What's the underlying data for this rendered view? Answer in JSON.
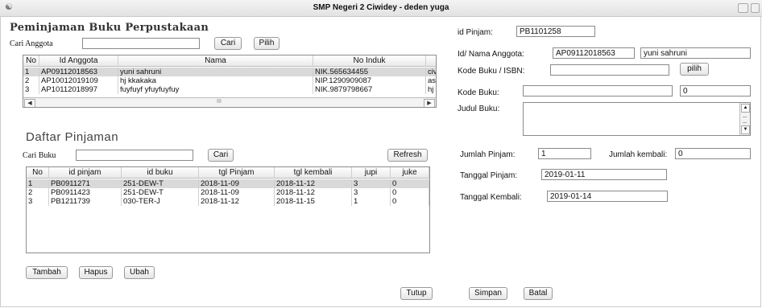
{
  "window": {
    "title": "SMP Negeri 2 Ciwidey - deden yuga"
  },
  "left": {
    "heading": "Peminjaman Buku Perpustakaan",
    "cari_anggota_label": "Cari Anggota",
    "cari_anggota_value": "",
    "cari_button": "Cari",
    "pilih_button": "Pilih",
    "anggota_table": {
      "columns": [
        "No",
        "Id Anggota",
        "Nama",
        "No Induk"
      ],
      "rows": [
        {
          "no": "1",
          "id": "AP09112018563",
          "nama": "yuni sahruni",
          "induk": "NIK.565634455",
          "extra": "civ"
        },
        {
          "no": "2",
          "id": "AP10012019109",
          "nama": "hj kkakaka",
          "induk": "NIP.1290909087",
          "extra": "as"
        },
        {
          "no": "3",
          "id": "AP10112018997",
          "nama": "fuyfuyf yfuyfuyfuy",
          "induk": "NIK.9879798667",
          "extra": "hj"
        }
      ],
      "scroll_thumb": "III"
    },
    "daftar_heading": "Daftar Pinjaman",
    "cari_buku_label": "Cari Buku",
    "cari_buku_value": "",
    "cari_buku_button": "Cari",
    "refresh_button": "Refresh",
    "pinjam_table": {
      "columns": [
        "No",
        "id pinjam",
        "id buku",
        "tgl Pinjam",
        "tgl kembali",
        "jupi",
        "juke"
      ],
      "rows": [
        {
          "no": "1",
          "id_pinjam": "PB0911271",
          "id_buku": "251-DEW-T",
          "tgl_pinjam": "2018-11-09",
          "tgl_kembali": "2018-11-12",
          "jupi": "3",
          "juke": "0"
        },
        {
          "no": "2",
          "id_pinjam": "PB0911423",
          "id_buku": "251-DEW-T",
          "tgl_pinjam": "2018-11-09",
          "tgl_kembali": "2018-11-12",
          "jupi": "3",
          "juke": "0"
        },
        {
          "no": "3",
          "id_pinjam": "PB1211739",
          "id_buku": "030-TER-J",
          "tgl_pinjam": "2018-11-12",
          "tgl_kembali": "2018-11-15",
          "jupi": "1",
          "juke": "0"
        }
      ]
    },
    "tambah_button": "Tambah",
    "hapus_button": "Hapus",
    "ubah_button": "Ubah",
    "tutup_button": "Tutup"
  },
  "right": {
    "id_pinjam_label": "id Pinjam:",
    "id_pinjam_value": "PB1101258",
    "anggota_label": "Id/ Nama Anggota:",
    "anggota_id_value": "AP09112018563",
    "anggota_nama_value": "yuni sahruni",
    "kode_isbn_label": "Kode Buku / ISBN:",
    "kode_isbn_value": "",
    "pilih_button": "pilih",
    "kode_buku_label": "Kode Buku:",
    "kode_buku_value": "",
    "kode_buku_count": "0",
    "judul_label": "Judul Buku:",
    "jumlah_pinjam_label": "Jumlah Pinjam:",
    "jumlah_pinjam_value": "1",
    "jumlah_kembali_label": "Jumlah kembali:",
    "jumlah_kembali_value": "0",
    "tgl_pinjam_label": "Tanggal Pinjam:",
    "tgl_pinjam_value": "2019-01-11",
    "tgl_kembali_label": "Tanggal Kembali:",
    "tgl_kembali_value": "2019-01-14",
    "simpan_button": "Simpan",
    "batal_button": "Batal"
  }
}
